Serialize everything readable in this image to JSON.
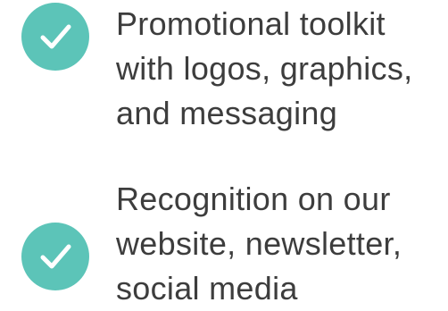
{
  "benefits": [
    {
      "icon": "checkmark-circle-icon",
      "lines": [
        "Promotional toolkit",
        "with logos, graphics,",
        "and messaging"
      ]
    },
    {
      "icon": "checkmark-circle-icon",
      "lines": [
        "Recognition on our",
        "website, newsletter,",
        "social media"
      ]
    }
  ],
  "colors": {
    "accent": "#5cc4b8",
    "text": "#3d3d3d",
    "check": "#ffffff"
  }
}
